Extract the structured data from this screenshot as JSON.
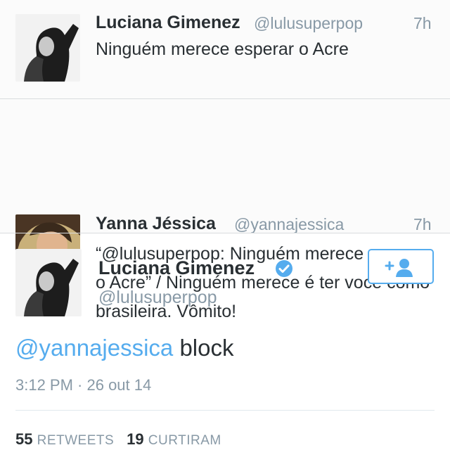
{
  "tweets": [
    {
      "name": "Luciana Gimenez",
      "handle": "@lulusuperpop",
      "time": "7h",
      "text": "Ninguém merece esperar o Acre"
    },
    {
      "name": "Yanna Jéssica",
      "handle": "@yannajessica",
      "time": "7h",
      "text": "“@lulusuperpop: Ninguém merece esperar o Acre” / Ninguém merece é ter você como brasileira. Vômito!"
    }
  ],
  "detail": {
    "name": "Luciana Gimenez",
    "handle": "@lulusuperpop",
    "verified": true,
    "mention": "@yannajessica",
    "text_rest": " block",
    "timestamp": "3:12 PM · 26 out 14",
    "retweets_count": "55",
    "retweets_label": "RETWEETS",
    "likes_count": "19",
    "likes_label": "CURTIRAM",
    "follow_icon": "add-user-icon"
  },
  "colors": {
    "link_blue": "#55acee",
    "muted_gray": "#8899a6",
    "text_dark": "#292f33"
  }
}
